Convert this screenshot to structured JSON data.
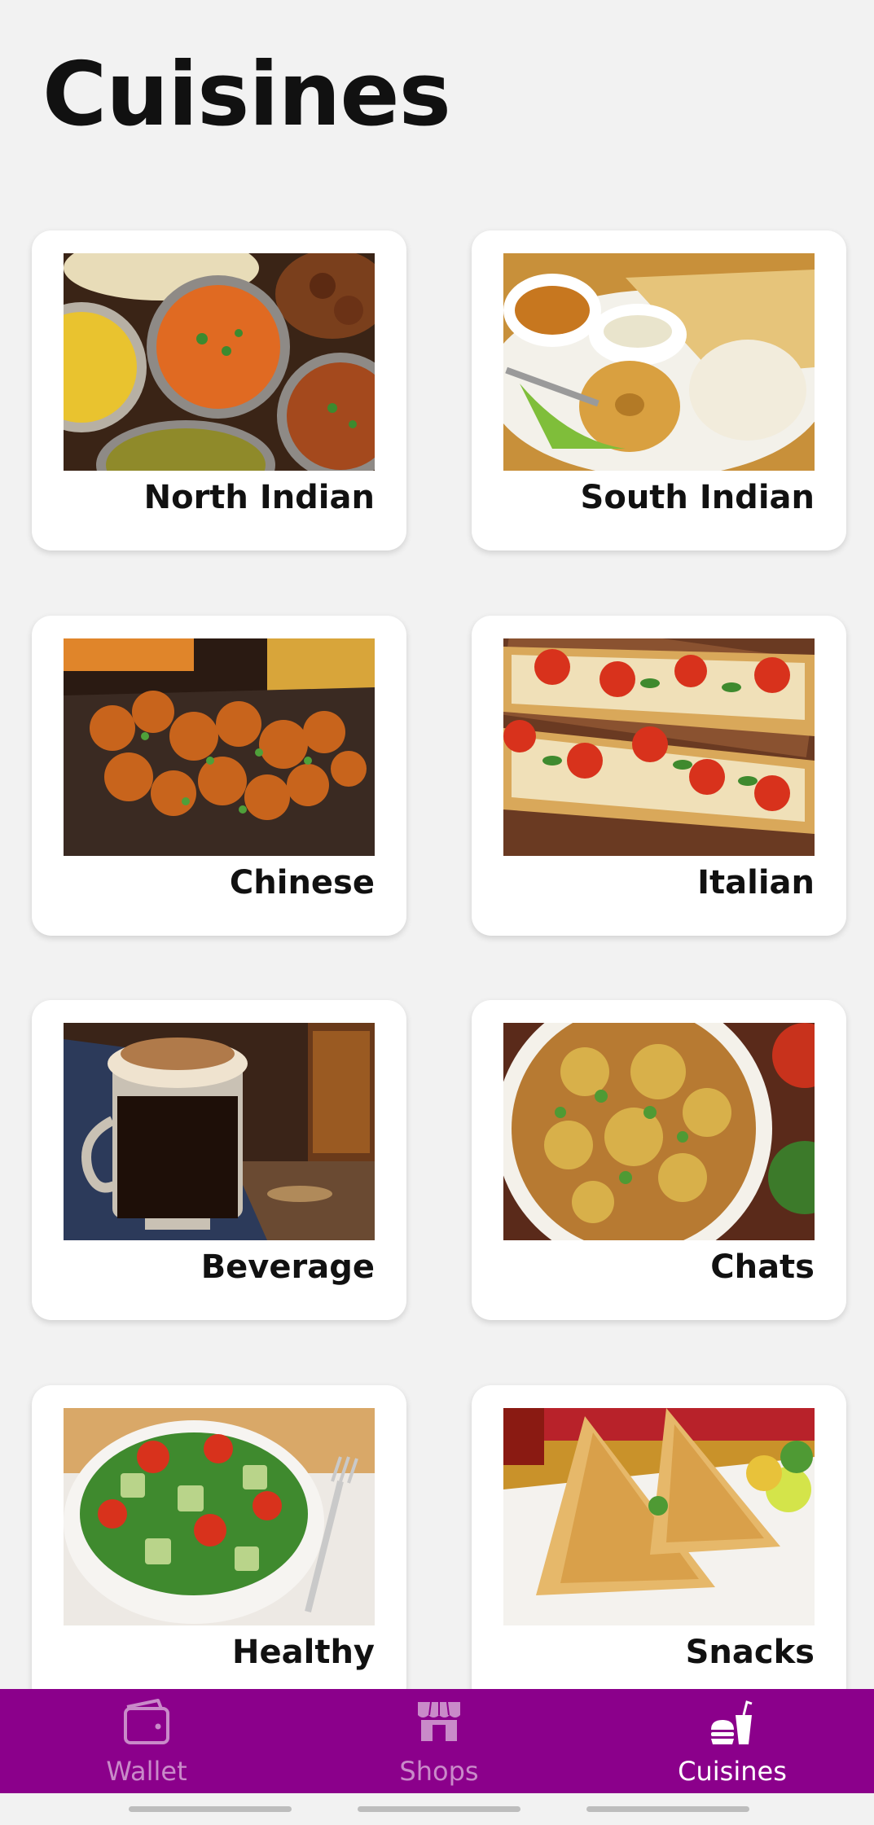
{
  "page": {
    "title": "Cuisines"
  },
  "cuisines": [
    {
      "label": "North Indian",
      "image": "north-indian-food-photo"
    },
    {
      "label": "South Indian",
      "image": "south-indian-food-photo"
    },
    {
      "label": "Chinese",
      "image": "chinese-food-photo"
    },
    {
      "label": "Italian",
      "image": "italian-food-photo"
    },
    {
      "label": "Beverage",
      "image": "beverage-photo"
    },
    {
      "label": "Chats",
      "image": "chats-food-photo"
    },
    {
      "label": "Healthy",
      "image": "healthy-food-photo"
    },
    {
      "label": "Snacks",
      "image": "snacks-food-photo"
    }
  ],
  "bottom_nav": {
    "items": [
      {
        "label": "Wallet",
        "icon": "wallet-icon",
        "active": false
      },
      {
        "label": "Shops",
        "icon": "shop-icon",
        "active": false
      },
      {
        "label": "Cuisines",
        "icon": "fastfood-icon",
        "active": true
      }
    ]
  },
  "colors": {
    "nav_background": "#8b008b",
    "nav_inactive": "#c98ac9",
    "nav_active": "#ffffff",
    "page_background": "#f2f2f2"
  }
}
